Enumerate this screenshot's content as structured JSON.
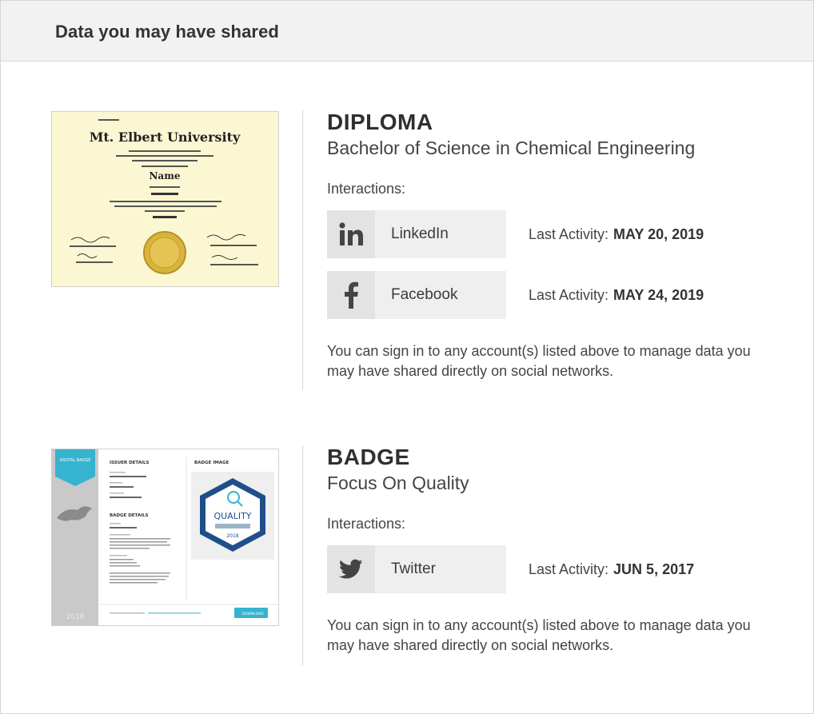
{
  "header": {
    "title": "Data you may have shared"
  },
  "credentials": [
    {
      "type": "DIPLOMA",
      "name": "Bachelor of Science in Chemical Engineering",
      "interactions_label": "Interactions:",
      "interactions": [
        {
          "network": "LinkedIn",
          "icon": "linkedin-icon",
          "activity_label": "Last Activity:",
          "date": "MAY 20, 2019"
        },
        {
          "network": "Facebook",
          "icon": "facebook-icon",
          "activity_label": "Last Activity:",
          "date": "MAY 24, 2019"
        }
      ],
      "note": "You can sign in to any account(s) listed above to manage data you may have shared directly on social networks.",
      "thumbnail": {
        "university": "Mt. Elbert University",
        "recipient": "Name"
      }
    },
    {
      "type": "BADGE",
      "name": "Focus On Quality",
      "interactions_label": "Interactions:",
      "interactions": [
        {
          "network": "Twitter",
          "icon": "twitter-icon",
          "activity_label": "Last Activity:",
          "date": "JUN 5, 2017"
        }
      ],
      "note": "You can sign in to any account(s) listed above to manage data you may have shared directly on social networks.",
      "thumbnail": {
        "ribbon": "DIGITAL BADGE",
        "issuer_heading": "ISSUER DETAILS",
        "image_heading": "BADGE IMAGE",
        "badge_details_heading": "BADGE DETAILS",
        "badge_word": "QUALITY",
        "badge_year": "2018",
        "year": "2018",
        "download": "DOWNLOAD"
      }
    }
  ],
  "colors": {
    "header_bg": "#f2f2f2",
    "diploma_paper": "#fbf7d2",
    "badge_teal": "#35b3cf",
    "badge_navy": "#1f4f8a",
    "seal_gold": "#d9b43a"
  }
}
